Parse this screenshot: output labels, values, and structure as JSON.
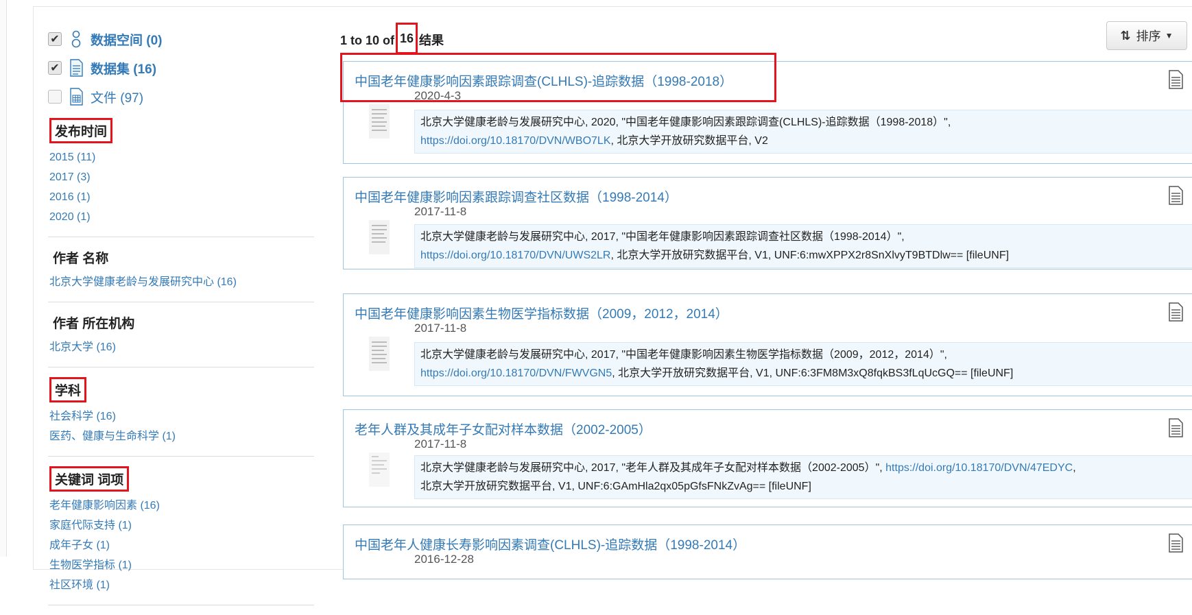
{
  "types": [
    {
      "label": "数据空间 (0)",
      "checked": true,
      "icon": "dataverse-icon"
    },
    {
      "label": "数据集 (16)",
      "checked": true,
      "icon": "dataset-icon"
    },
    {
      "label": "文件 (97)",
      "checked": false,
      "icon": "file-icon"
    }
  ],
  "facets": {
    "pubdate": {
      "title": "发布时间",
      "items": [
        "2015 (11)",
        "2017 (3)",
        "2016 (1)",
        "2020 (1)"
      ]
    },
    "author": {
      "title": "作者 名称",
      "items": [
        "北京大学健康老龄与发展研究中心 (16)"
      ]
    },
    "affiliation": {
      "title": "作者 所在机构",
      "items": [
        "北京大学 (16)"
      ]
    },
    "subject": {
      "title": "学科",
      "items": [
        "社会科学 (16)",
        "医药、健康与生命科学 (1)"
      ]
    },
    "keyword": {
      "title": "关键词 词项",
      "items": [
        "老年健康影响因素 (16)",
        "家庭代际支持 (1)",
        "成年子女 (1)",
        "生物医学指标 (1)",
        "社区环境 (1)"
      ]
    }
  },
  "results_header": {
    "prefix": "1 to 10 of",
    "count": "16",
    "suffix": "结果"
  },
  "sort": {
    "label": "排序"
  },
  "results": [
    {
      "title": "中国老年健康影响因素跟踪调查(CLHLS)-追踪数据（1998-2018）",
      "date": "2020-4-3",
      "cite_text": "北京大学健康老龄与发展研究中心, 2020, \"中国老年健康影响因素跟踪调查(CLHLS)-追踪数据（1998-2018）\",",
      "cite_link": "https://doi.org/10.18170/DVN/WBO7LK",
      "cite_rest": ", 北京大学开放研究数据平台, V2"
    },
    {
      "title": "中国老年健康影响因素跟踪调查社区数据（1998-2014）",
      "date": "2017-11-8",
      "cite_text": "北京大学健康老龄与发展研究中心, 2017, \"中国老年健康影响因素跟踪调查社区数据（1998-2014）\",",
      "cite_link": "https://doi.org/10.18170/DVN/UWS2LR",
      "cite_rest": ", 北京大学开放研究数据平台, V1, UNF:6:mwXPPX2r8SnXlvyT9BTDlw== [fileUNF]"
    },
    {
      "title": "中国老年健康影响因素生物医学指标数据（2009，2012，2014）",
      "date": "2017-11-8",
      "cite_text": "北京大学健康老龄与发展研究中心, 2017, \"中国老年健康影响因素生物医学指标数据（2009，2012，2014）\",",
      "cite_link": "https://doi.org/10.18170/DVN/FWVGN5",
      "cite_rest": ", 北京大学开放研究数据平台, V1, UNF:6:3FM8M3xQ8fqkBS3fLqUcGQ== [fileUNF]"
    },
    {
      "title": "老年人群及其成年子女配对样本数据（2002-2005）",
      "date": "2017-11-8",
      "cite_text": "北京大学健康老龄与发展研究中心, 2017, \"老年人群及其成年子女配对样本数据（2002-2005）\",",
      "cite_link": "https://doi.org/10.18170/DVN/47EDYC",
      "cite_rest": "北京大学开放研究数据平台, V1, UNF:6:GAmHla2qx05pGfsFNkZvAg== [fileUNF]"
    },
    {
      "title": "中国老年人健康长寿影响因素调查(CLHLS)-追踪数据（1998-2014）",
      "date": "2016-12-28"
    }
  ]
}
